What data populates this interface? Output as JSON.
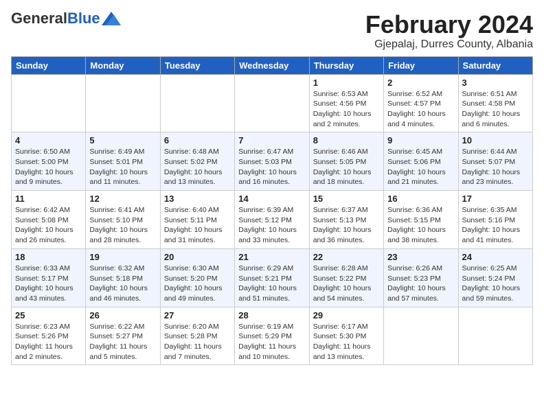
{
  "header": {
    "logo_general": "General",
    "logo_blue": "Blue",
    "month_year": "February 2024",
    "location": "Gjepalaj, Durres County, Albania"
  },
  "weekdays": [
    "Sunday",
    "Monday",
    "Tuesday",
    "Wednesday",
    "Thursday",
    "Friday",
    "Saturday"
  ],
  "weeks": [
    [
      {
        "day": "",
        "info": ""
      },
      {
        "day": "",
        "info": ""
      },
      {
        "day": "",
        "info": ""
      },
      {
        "day": "",
        "info": ""
      },
      {
        "day": "1",
        "info": "Sunrise: 6:53 AM\nSunset: 4:56 PM\nDaylight: 10 hours\nand 2 minutes."
      },
      {
        "day": "2",
        "info": "Sunrise: 6:52 AM\nSunset: 4:57 PM\nDaylight: 10 hours\nand 4 minutes."
      },
      {
        "day": "3",
        "info": "Sunrise: 6:51 AM\nSunset: 4:58 PM\nDaylight: 10 hours\nand 6 minutes."
      }
    ],
    [
      {
        "day": "4",
        "info": "Sunrise: 6:50 AM\nSunset: 5:00 PM\nDaylight: 10 hours\nand 9 minutes."
      },
      {
        "day": "5",
        "info": "Sunrise: 6:49 AM\nSunset: 5:01 PM\nDaylight: 10 hours\nand 11 minutes."
      },
      {
        "day": "6",
        "info": "Sunrise: 6:48 AM\nSunset: 5:02 PM\nDaylight: 10 hours\nand 13 minutes."
      },
      {
        "day": "7",
        "info": "Sunrise: 6:47 AM\nSunset: 5:03 PM\nDaylight: 10 hours\nand 16 minutes."
      },
      {
        "day": "8",
        "info": "Sunrise: 6:46 AM\nSunset: 5:05 PM\nDaylight: 10 hours\nand 18 minutes."
      },
      {
        "day": "9",
        "info": "Sunrise: 6:45 AM\nSunset: 5:06 PM\nDaylight: 10 hours\nand 21 minutes."
      },
      {
        "day": "10",
        "info": "Sunrise: 6:44 AM\nSunset: 5:07 PM\nDaylight: 10 hours\nand 23 minutes."
      }
    ],
    [
      {
        "day": "11",
        "info": "Sunrise: 6:42 AM\nSunset: 5:08 PM\nDaylight: 10 hours\nand 26 minutes."
      },
      {
        "day": "12",
        "info": "Sunrise: 6:41 AM\nSunset: 5:10 PM\nDaylight: 10 hours\nand 28 minutes."
      },
      {
        "day": "13",
        "info": "Sunrise: 6:40 AM\nSunset: 5:11 PM\nDaylight: 10 hours\nand 31 minutes."
      },
      {
        "day": "14",
        "info": "Sunrise: 6:39 AM\nSunset: 5:12 PM\nDaylight: 10 hours\nand 33 minutes."
      },
      {
        "day": "15",
        "info": "Sunrise: 6:37 AM\nSunset: 5:13 PM\nDaylight: 10 hours\nand 36 minutes."
      },
      {
        "day": "16",
        "info": "Sunrise: 6:36 AM\nSunset: 5:15 PM\nDaylight: 10 hours\nand 38 minutes."
      },
      {
        "day": "17",
        "info": "Sunrise: 6:35 AM\nSunset: 5:16 PM\nDaylight: 10 hours\nand 41 minutes."
      }
    ],
    [
      {
        "day": "18",
        "info": "Sunrise: 6:33 AM\nSunset: 5:17 PM\nDaylight: 10 hours\nand 43 minutes."
      },
      {
        "day": "19",
        "info": "Sunrise: 6:32 AM\nSunset: 5:18 PM\nDaylight: 10 hours\nand 46 minutes."
      },
      {
        "day": "20",
        "info": "Sunrise: 6:30 AM\nSunset: 5:20 PM\nDaylight: 10 hours\nand 49 minutes."
      },
      {
        "day": "21",
        "info": "Sunrise: 6:29 AM\nSunset: 5:21 PM\nDaylight: 10 hours\nand 51 minutes."
      },
      {
        "day": "22",
        "info": "Sunrise: 6:28 AM\nSunset: 5:22 PM\nDaylight: 10 hours\nand 54 minutes."
      },
      {
        "day": "23",
        "info": "Sunrise: 6:26 AM\nSunset: 5:23 PM\nDaylight: 10 hours\nand 57 minutes."
      },
      {
        "day": "24",
        "info": "Sunrise: 6:25 AM\nSunset: 5:24 PM\nDaylight: 10 hours\nand 59 minutes."
      }
    ],
    [
      {
        "day": "25",
        "info": "Sunrise: 6:23 AM\nSunset: 5:26 PM\nDaylight: 11 hours\nand 2 minutes."
      },
      {
        "day": "26",
        "info": "Sunrise: 6:22 AM\nSunset: 5:27 PM\nDaylight: 11 hours\nand 5 minutes."
      },
      {
        "day": "27",
        "info": "Sunrise: 6:20 AM\nSunset: 5:28 PM\nDaylight: 11 hours\nand 7 minutes."
      },
      {
        "day": "28",
        "info": "Sunrise: 6:19 AM\nSunset: 5:29 PM\nDaylight: 11 hours\nand 10 minutes."
      },
      {
        "day": "29",
        "info": "Sunrise: 6:17 AM\nSunset: 5:30 PM\nDaylight: 11 hours\nand 13 minutes."
      },
      {
        "day": "",
        "info": ""
      },
      {
        "day": "",
        "info": ""
      }
    ]
  ]
}
